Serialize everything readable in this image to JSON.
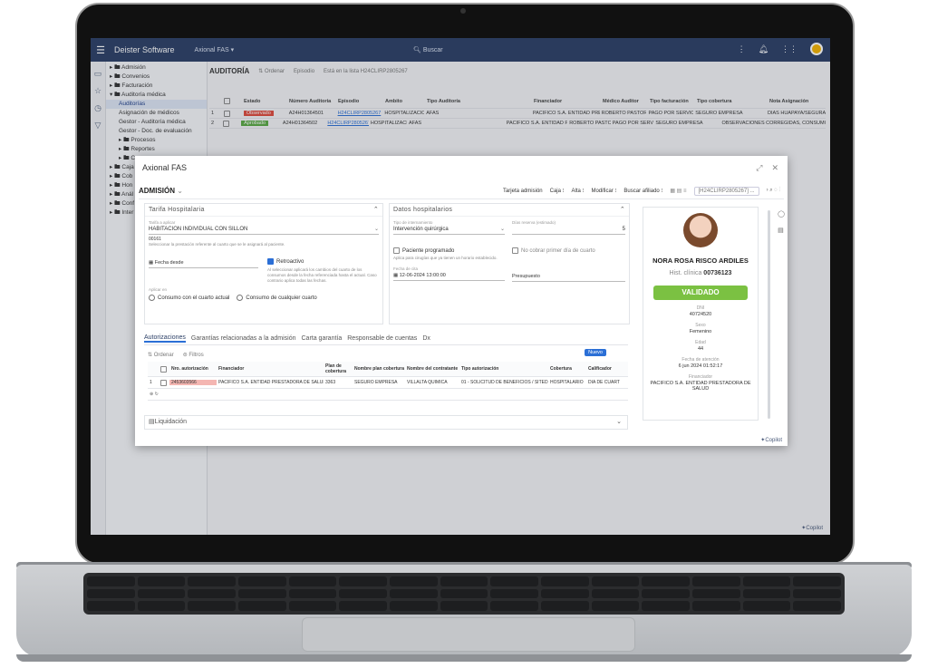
{
  "topbar": {
    "brand": "Deister Software",
    "app": "Axional FAS",
    "search_placeholder": "Buscar"
  },
  "tree": [
    {
      "label": "▸ 🖿 Admisión",
      "indent": 0
    },
    {
      "label": "▸ 🖿 Convenios",
      "indent": 0
    },
    {
      "label": "▸ 🖿 Facturación",
      "indent": 0
    },
    {
      "label": "▾ 🖿 Auditoría médica",
      "indent": 0
    },
    {
      "label": "Auditorías",
      "indent": 1,
      "selected": true
    },
    {
      "label": "Asignación de médicos",
      "indent": 1
    },
    {
      "label": "Gestor - Auditoría médica",
      "indent": 1
    },
    {
      "label": "Gestor - Doc. de evaluación",
      "indent": 1
    },
    {
      "label": "▸ 🖿 Procesos",
      "indent": 1
    },
    {
      "label": "▸ 🖿 Reportes",
      "indent": 1
    },
    {
      "label": "▸ 🖿 C",
      "indent": 1
    },
    {
      "label": "▸ 🖿 Caja",
      "indent": 0
    },
    {
      "label": "▸ 🖿 Cob",
      "indent": 0
    },
    {
      "label": "▸ 🖿 Hon",
      "indent": 0
    },
    {
      "label": "▸ 🖿 Anál",
      "indent": 0
    },
    {
      "label": "▸ 🖿 Conf",
      "indent": 0
    },
    {
      "label": "▸ 🖿 Inter",
      "indent": 0
    }
  ],
  "main": {
    "title": "AUDITORÍA",
    "ordenar": "Ordenar",
    "sub": "Episodio",
    "filter_chip": "Está en la lista H24CLIRP2805267",
    "columns": [
      "Estado",
      "Número Auditoria",
      "Episodio",
      "Ámbito",
      "Tipo Auditoría",
      "Financiador",
      "Médico Auditor",
      "Tipo facturación",
      "Tipo cobertura",
      "Nota Asignación"
    ],
    "rows": [
      {
        "n": "1",
        "estado": "Observado",
        "color": "#e04a3c",
        "num": "A24H01364501",
        "epi": "H24CLIRP2805267",
        "amb": "HOSPITALIZACION",
        "tipo": "AFAS",
        "fin": "PACIFICO S.A. ENTIDAD PRESTADORA DE SALUD",
        "med": "ROBERTO PASTOR VERGARAY",
        "fac": "PAGO POR SERVICIO",
        "cob": "SEGURO EMPRESA",
        "nota": "DIAS HUAPAYA/SEGURA"
      },
      {
        "n": "2",
        "estado": "Aprobado",
        "color": "#5aaa44",
        "num": "A24H01364502",
        "epi": "H24CLIRP2805267",
        "amb": "HOSPITALIZACION",
        "tipo": "AFAS",
        "fin": "PACIFICO S.A. ENTIDAD PRESTADORA DE SALUD",
        "med": "ROBERTO PASTOR VERGARAY",
        "fac": "PAGO POR SERVICIO",
        "cob": "SEGURO EMPRESA",
        "nota": "OBSERVACIONES CORREGIDAS, CONSUMOS..."
      }
    ],
    "copilot": "Copilot"
  },
  "dialog": {
    "title": "Axional FAS",
    "section": "ADMISIÓN",
    "actions": [
      "Tarjeta admisión",
      "Caja ⁝",
      "Alta ⁝",
      "Modificar ⁝",
      "Buscar afiliado ⁝"
    ],
    "episode_chip": "[H24CLIRP2805267] ...",
    "tarifa": {
      "header": "Tarifa Hospitalaria",
      "tarifa_label": "Tarifa a aplicar",
      "tarifa_value": "HABITACION INDIVIDUAL CON SILLON",
      "code": "00161",
      "code_hint": "Seleccionar la prestación referente al cuarto que se le asignará al paciente.",
      "fecha_label": "Fecha desde",
      "retro_label": "Retroactivo",
      "retro_hint": "Al seleccionar aplicará los cambios del cuarto de los consumos desde la fecha referenciada hasta el actual. Caso contrario aplica todas las fechas.",
      "aplicar_label": "Aplicar en",
      "opt1": "Consumo con el cuarto actual",
      "opt2": "Consumo de cualquier cuarto"
    },
    "datos": {
      "header": "Datos hospitalarios",
      "tipo_label": "Tipo de internamiento",
      "tipo_value": "Intervención quirúrgica",
      "dias_label": "Días reserva (estimado)",
      "dias_value": "5",
      "prog_label": "Paciente programado",
      "prog_hint": "Aplica para cirugías que ya tienen un horario establecido.",
      "cobrar_label": "No cobrar primer día de cuarto",
      "fecha_label": "Fecha de cita",
      "fecha_value": "12-06-2024 13:00:00",
      "presupuesto_label": "Presupuesto"
    },
    "tabs": [
      "Autorizaciones",
      "Garantías relacionadas a la admisión",
      "Carta garantía",
      "Responsable de cuentas",
      "Dx"
    ],
    "auth": {
      "ordenar": "Ordenar",
      "filtros": "Filtros",
      "nuevo": "Nuevo",
      "columns": [
        "Nro. autorización",
        "Financiador",
        "Plan de cobertura",
        "Nombre plan cobertura",
        "Nombre del contratante",
        "Tipo autorización",
        "Cobertura",
        "Calificador"
      ],
      "row": {
        "n": "1",
        "nro": "2453603566",
        "fin": "PACIFICO S.A. ENTIDAD PRESTADORA DE SALUD",
        "plan": "3363",
        "nombre_plan": "SEGURO EMPRESA",
        "contratante": "VILLALTA QUIMICA",
        "tipo": "01 - SOLICITUD DE BENEFICIOS / SITEDS",
        "cob": "HOSPITALARIO",
        "calif": "DIA DE CUART"
      }
    },
    "liquidacion": "Liquidación",
    "patient": {
      "name": "NORA ROSA RISCO ARDILES",
      "hist_label": "Hist. clínica",
      "hist_value": "00736123",
      "status": "VALIDADO",
      "fields": [
        {
          "k": "DNI",
          "v": "40724520"
        },
        {
          "k": "Sexo",
          "v": "Femenino"
        },
        {
          "k": "Edad",
          "v": "44"
        },
        {
          "k": "Fecha de atención",
          "v": "6 jun 2024 01:52:17"
        },
        {
          "k": "Financiador",
          "v": "PACIFICO S.A. ENTIDAD PRESTADORA DE SALUD"
        }
      ]
    },
    "copilot": "Copilot"
  }
}
